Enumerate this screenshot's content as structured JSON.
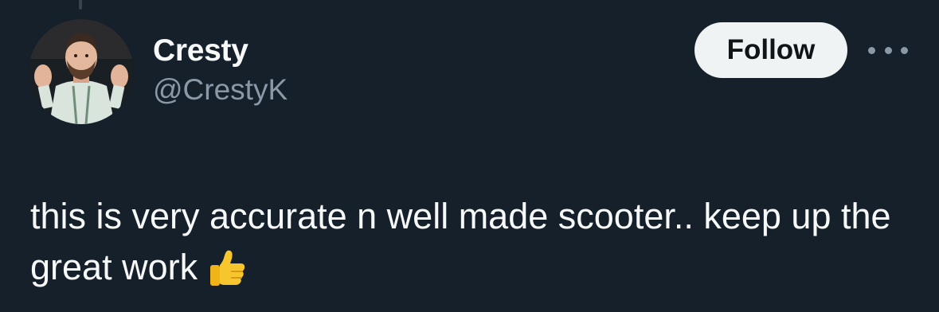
{
  "author": {
    "display_name": "Cresty",
    "handle": "@CrestyK"
  },
  "actions": {
    "follow_label": "Follow",
    "more_icon": "more-horizontal-icon"
  },
  "tweet": {
    "text": "this is very accurate n well made scooter.. keep up the great work",
    "emoji": "thumbs-up-icon"
  },
  "colors": {
    "background": "#15202b",
    "primary_text": "#f7f9f9",
    "secondary_text": "#8b98a5",
    "follow_bg": "#eff3f4",
    "follow_text": "#0f1419"
  }
}
